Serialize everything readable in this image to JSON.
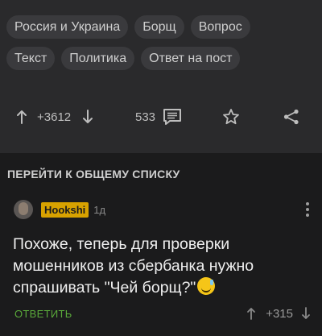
{
  "tags": {
    "row1": [
      "Россия и Украина",
      "Борщ",
      "Вопрос"
    ],
    "row2": [
      "Текст",
      "Политика",
      "Ответ на пост"
    ]
  },
  "post_actions": {
    "rating": "+3612",
    "comments_count": "533",
    "upvote_icon": "arrow-up-icon",
    "downvote_icon": "arrow-down-icon",
    "comments_icon": "comments-icon",
    "save_icon": "star-icon",
    "share_icon": "share-icon"
  },
  "section": {
    "title": "ПЕРЕЙТИ К ОБЩЕМУ СПИСКУ"
  },
  "comment": {
    "username": "Hookshi",
    "time": "1д",
    "text": "Похоже, теперь для проверки мошенников из сбербанка нужно спрашивать \"Чей борщ?\"",
    "reply_label": "ОТВЕТИТЬ",
    "rating": "+315"
  },
  "colors": {
    "background": "#1b1b1c",
    "post_background": "#2a2a2c",
    "username_badge": "#d8a200",
    "reply_link": "#5aa93a"
  }
}
